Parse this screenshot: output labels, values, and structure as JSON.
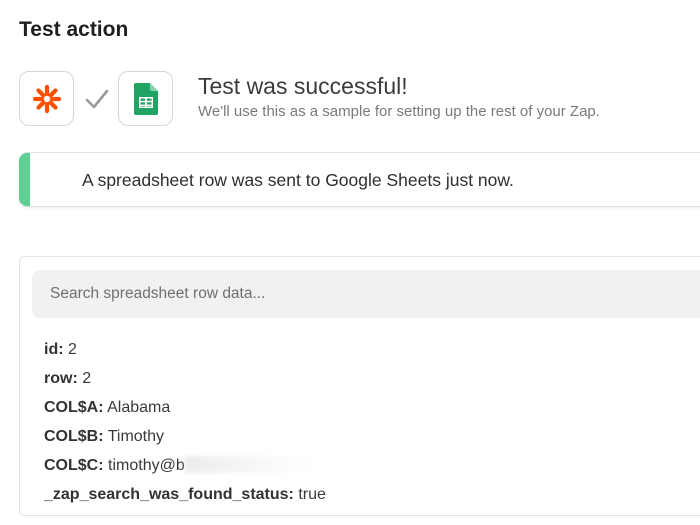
{
  "section": {
    "title": "Test action"
  },
  "apps": {
    "source": {
      "icon": "zapier-asterisk-icon",
      "color": "#ff4f00"
    },
    "connector_icon": "checkmark-icon",
    "target": {
      "icon": "google-sheets-icon",
      "color": "#1fa463"
    }
  },
  "status": {
    "title": "Test was successful!",
    "subtitle": "We'll use this as a sample for setting up the rest of your Zap."
  },
  "banner": {
    "message": "A spreadsheet row was sent to Google Sheets just now.",
    "accent_color": "#5fcf94"
  },
  "data_panel": {
    "search": {
      "value": "",
      "placeholder": "Search spreadsheet row data..."
    },
    "fields": [
      {
        "key": "id:",
        "value": "2"
      },
      {
        "key": "row:",
        "value": "2"
      },
      {
        "key": "COL$A:",
        "value": "Alabama"
      },
      {
        "key": "COL$B:",
        "value": "Timothy"
      },
      {
        "key": "COL$C:",
        "value": "timothy@b"
      },
      {
        "key": "_zap_search_was_found_status:",
        "value": "true"
      }
    ]
  }
}
